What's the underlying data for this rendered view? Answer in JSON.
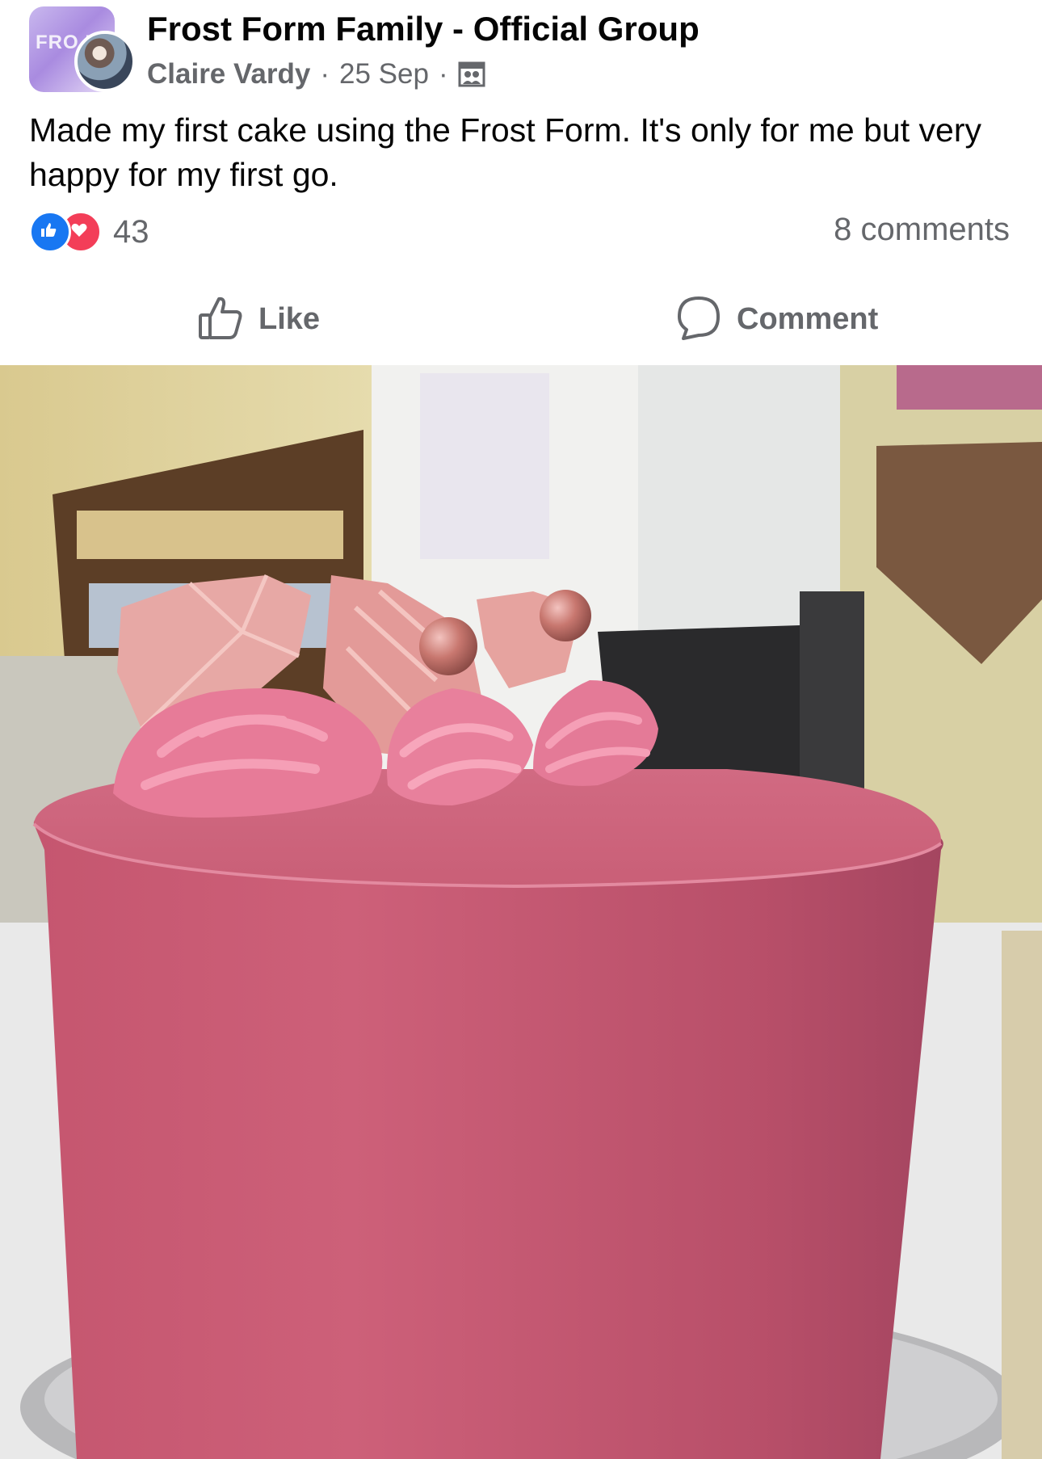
{
  "post": {
    "group_name": "Frost Form Family - Official Group",
    "group_avatar_text": "FRO FO",
    "author": "Claire Vardy",
    "separator": "·",
    "date": "25 Sep",
    "audience_icon": "group-members-icon",
    "text": "Made my first cake using the Frost Form. It's only for me but very happy for my first go."
  },
  "engagement": {
    "reaction_icons": [
      "like-reaction-icon",
      "love-reaction-icon"
    ],
    "reaction_count": "43",
    "comments": "8 comments"
  },
  "actions": {
    "like_label": "Like",
    "comment_label": "Comment"
  },
  "colors": {
    "like_blue": "#1877f2",
    "love_red": "#f33e58",
    "secondary_text": "#65676b",
    "cake_pink": "#c85a72"
  }
}
